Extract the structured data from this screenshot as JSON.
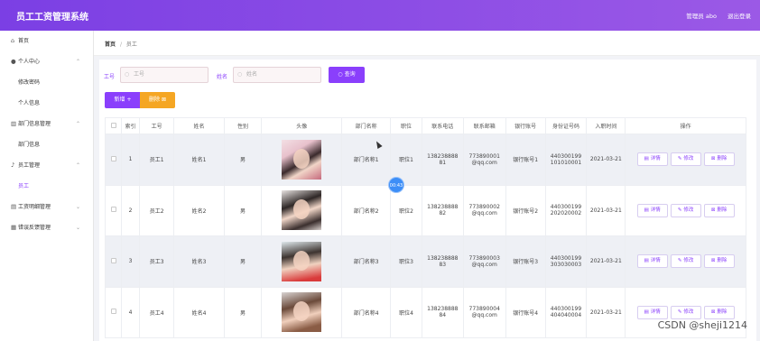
{
  "header": {
    "title": "员工工资管理系统",
    "user": "管理员 abo",
    "logout": "退出登录"
  },
  "sidebar": {
    "items": [
      {
        "label": "首页",
        "icon": "home-icon",
        "glyph": "⌂",
        "arrow": "",
        "level": "top"
      },
      {
        "label": "个人中心",
        "icon": "user-icon",
        "glyph": "●",
        "arrow": "⌃",
        "level": "top"
      },
      {
        "label": "修改密码",
        "icon": "",
        "glyph": "",
        "arrow": "",
        "level": "sub"
      },
      {
        "label": "个人信息",
        "icon": "",
        "glyph": "",
        "arrow": "",
        "level": "sub"
      },
      {
        "label": "部门信息管理",
        "icon": "chart-icon",
        "glyph": "▥",
        "arrow": "⌃",
        "level": "top"
      },
      {
        "label": "部门信息",
        "icon": "",
        "glyph": "",
        "arrow": "",
        "level": "sub"
      },
      {
        "label": "员工管理",
        "icon": "microphone-icon",
        "glyph": "♪",
        "arrow": "⌃",
        "level": "top"
      },
      {
        "label": "员工",
        "icon": "",
        "glyph": "",
        "arrow": "",
        "level": "sub",
        "active": true
      },
      {
        "label": "工资明细管理",
        "icon": "document-icon",
        "glyph": "▤",
        "arrow": "⌄",
        "level": "top"
      },
      {
        "label": "错误反馈管理",
        "icon": "list-icon",
        "glyph": "▦",
        "arrow": "⌄",
        "level": "top"
      }
    ]
  },
  "breadcrumb": {
    "home": "首页",
    "separator": "/",
    "current": "员工"
  },
  "search": {
    "id_label": "工号",
    "id_placeholder": "工号",
    "name_label": "姓名",
    "name_placeholder": "姓名",
    "query_button": "查询"
  },
  "toolbar": {
    "add_button": "新增 +",
    "delete_button": "删除 ⊠"
  },
  "table": {
    "columns": [
      "",
      "索引",
      "工号",
      "姓名",
      "性别",
      "头像",
      "部门名称",
      "职位",
      "联系电话",
      "联系邮箱",
      "银行账号",
      "身份证号码",
      "入职时间",
      "操作"
    ],
    "rows": [
      {
        "index": "1",
        "id": "员工1",
        "name": "姓名1",
        "gender": "男",
        "dept": "部门名称1",
        "position": "职位1",
        "phone": [
          "138238888",
          "81"
        ],
        "email": [
          "773890001",
          "@qq.com"
        ],
        "bank": "银行账号1",
        "idcard": [
          "440300199",
          "101010001"
        ],
        "date": "2021-03-21"
      },
      {
        "index": "2",
        "id": "员工2",
        "name": "姓名2",
        "gender": "男",
        "dept": "部门名称2",
        "position": "职位2",
        "phone": [
          "138238888",
          "82"
        ],
        "email": [
          "773890002",
          "@qq.com"
        ],
        "bank": "银行账号2",
        "idcard": [
          "440300199",
          "202020002"
        ],
        "date": "2021-03-21"
      },
      {
        "index": "3",
        "id": "员工3",
        "name": "姓名3",
        "gender": "男",
        "dept": "部门名称3",
        "position": "职位3",
        "phone": [
          "138238888",
          "83"
        ],
        "email": [
          "773890003",
          "@qq.com"
        ],
        "bank": "银行账号3",
        "idcard": [
          "440300199",
          "303030003"
        ],
        "date": "2021-03-21"
      },
      {
        "index": "4",
        "id": "员工4",
        "name": "姓名4",
        "gender": "男",
        "dept": "部门名称4",
        "position": "职位4",
        "phone": [
          "138238888",
          "84"
        ],
        "email": [
          "773890004",
          "@qq.com"
        ],
        "bank": "银行账号4",
        "idcard": [
          "440300199",
          "404040004"
        ],
        "date": "2021-03-21"
      }
    ],
    "actions": {
      "detail": "详情",
      "edit": "修改",
      "delete": "删除"
    }
  },
  "overlay": {
    "recording_badge": "00:43",
    "watermark": "CSDN @sheji1214"
  },
  "colors": {
    "accent": "#8a3ffc",
    "header_start": "#7b3fe4",
    "header_end": "#9b59e6",
    "delete": "#f5a623"
  }
}
